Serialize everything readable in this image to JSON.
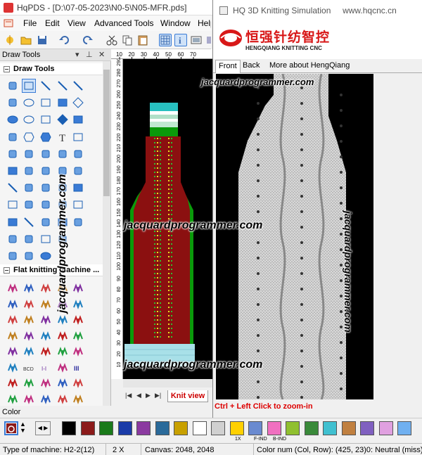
{
  "main_window": {
    "title": "HqPDS - [D:\\07-05-2023\\N0-5\\N05-MFR.pds]",
    "menu": [
      "File",
      "Edit",
      "View",
      "Advanced Tools",
      "Window",
      "Help"
    ]
  },
  "draw_tools": {
    "panel_title": "Draw Tools",
    "section1": "Draw Tools",
    "section2": "Flat knitting machine ...",
    "text_tool_glyph": "T",
    "stitch_labels": [
      "BCD",
      "I-I",
      "III"
    ]
  },
  "canvas": {
    "ruler_top": [
      "10",
      "20",
      "30",
      "40",
      "50",
      "60",
      "70"
    ],
    "ruler_left": [
      "290",
      "280",
      "270",
      "260",
      "250",
      "240",
      "230",
      "220",
      "210",
      "200",
      "190",
      "180",
      "170",
      "160",
      "150",
      "140",
      "130",
      "120",
      "110",
      "100",
      "90",
      "80",
      "70",
      "60",
      "50",
      "40",
      "30",
      "20",
      "10"
    ],
    "active_tab": "Knit view"
  },
  "simulation": {
    "window_title": "HQ 3D Knitting Simulation",
    "site": "www.hqcnc.cn",
    "brand_cn": "恒强针纺智控",
    "brand_en": "HENGQIANG KNITTING CNC",
    "tabs": [
      "Front",
      "Back",
      "More about HengQiang"
    ],
    "hint": "Ctrl + Left Click to zoom-in"
  },
  "colors": {
    "label": "Color",
    "swatches": [
      "#000000",
      "#8b1a1a",
      "#1a7a1a",
      "#1a3ba8",
      "#8b3aa0",
      "#2a6a9a",
      "#c8a000",
      "#ffffff",
      "#d0d0d0"
    ],
    "more_swatches": [
      "#ffd000",
      "#6a8ad0",
      "#f070c0",
      "#90c030",
      "#3a8a3a",
      "#40c0d0",
      "#c08040",
      "#8060c0",
      "#e0a0e0",
      "#70b0f0"
    ],
    "swatch_labels": [
      "1X",
      "F-IND",
      "B-IND"
    ]
  },
  "status": {
    "machine": "Type of machine: H2-2(12)",
    "zoom": "2 X",
    "canvas": "Canvas: 2048, 2048",
    "colornum": "Color num (Col, Row): (425, 23)0: Neutral (miss)"
  },
  "watermark": "jacquardprogrammer.com"
}
